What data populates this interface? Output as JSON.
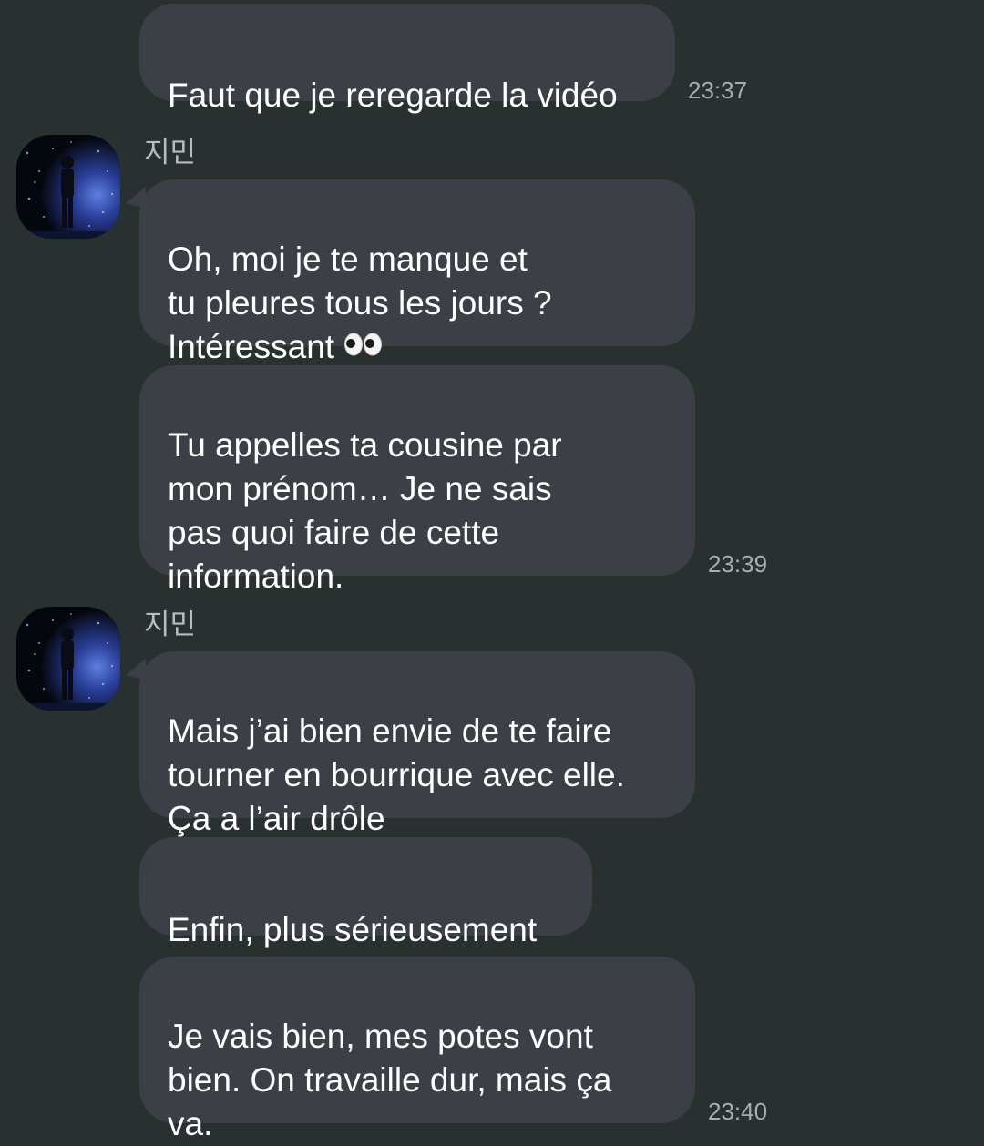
{
  "conversation": {
    "messages": [
      {
        "text": "Faut que je reregarde la vidéo",
        "time": "23:37"
      },
      {
        "sender": "지민",
        "text": "Oh, moi je te manque et\ntu pleures tous les jours ?\nIntéressant",
        "emoji": "eyes"
      },
      {
        "text": "Tu appelles ta cousine par\nmon prénom… Je ne sais\npas quoi faire de cette\ninformation.",
        "time": "23:39"
      },
      {
        "sender": "지민",
        "text": "Mais j’ai bien envie de te faire\ntourner en bourrique avec elle.\nÇa a l’air drôle"
      },
      {
        "text": "Enfin, plus sérieusement"
      },
      {
        "text": "Je vais bien, mes potes vont\nbien. On travaille dur, mais ça\nva.",
        "time": "23:40"
      }
    ]
  },
  "theme": {
    "background": "#293130",
    "bubble": "#3c3f45",
    "text": "#ffffff",
    "time": "#a9adb0"
  },
  "icons": {
    "avatar": "profile-photo-stage-silhouette",
    "emoji": "eyes-emoji"
  }
}
